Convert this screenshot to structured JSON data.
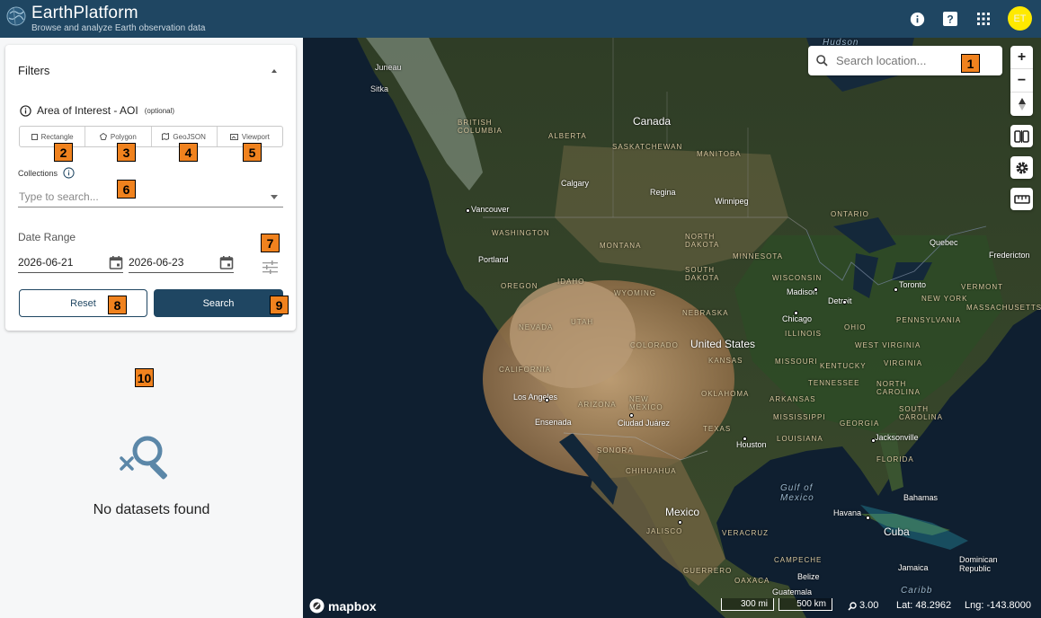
{
  "header": {
    "title": "EarthPlatform",
    "subtitle": "Browse and analyze Earth observation data",
    "avatar_initials": "ET",
    "icons": [
      "info-icon",
      "help-icon",
      "apps-grid-icon"
    ]
  },
  "filters": {
    "title": "Filters",
    "aoi_label": "Area of Interest - AOI",
    "aoi_optional": "(optional)",
    "aoi_options": [
      "Rectangle",
      "Polygon",
      "GeoJSON",
      "Viewport"
    ],
    "collections_label": "Collections",
    "collections_placeholder": "Type to search...",
    "date_range_label": "Date Range",
    "date_start": "2026-06-21",
    "date_end": "2026-06-23",
    "reset_label": "Reset",
    "search_label": "Search"
  },
  "results": {
    "empty_text": "No datasets found"
  },
  "map": {
    "search_placeholder": "Search location...",
    "zoom_in": "+",
    "zoom_out": "−",
    "attribution": "mapbox",
    "scale_mi": "300 mi",
    "scale_km": "500 km",
    "zoom_level": "3.00",
    "lat": "Lat:  48.2962",
    "lng": "Lng: -143.8000",
    "labels": {
      "hudson": "Hudson",
      "juneau": "Juneau",
      "sitka": "Sitka",
      "british_columbia": "BRITISH COLUMBIA",
      "alberta": "ALBERTA",
      "canada": "Canada",
      "saskatchewan": "SASKATCHEWAN",
      "manitoba": "MANITOBA",
      "calgary": "Calgary",
      "regina": "Regina",
      "winnipeg": "Winnipeg",
      "ontario": "ONTARIO",
      "vancouver": "Vancouver",
      "washington": "WASHINGTON",
      "montana": "MONTANA",
      "north_dakota": "NORTH DAKOTA",
      "minnesota": "MINNESOTA",
      "quebec": "Quebec",
      "fredericton": "Fredericton",
      "portland": "Portland",
      "oregon": "OREGON",
      "idaho": "IDAHO",
      "wyoming": "WYOMING",
      "south_dakota": "SOUTH DAKOTA",
      "wisconsin": "WISCONSIN",
      "madison": "Madison",
      "detroit": "Detroit",
      "toronto": "Toronto",
      "vermont": "VERMONT",
      "new_york": "NEW YORK",
      "massachusetts": "MASSACHUSETTS",
      "nebraska": "NEBRASKA",
      "chicago": "Chicago",
      "illinois": "ILLINOIS",
      "ohio": "OHIO",
      "pennsylvania": "PENNSYLVANIA",
      "nevada": "NEVADA",
      "utah": "UTAH",
      "colorado": "COLORADO",
      "united_states": "United States",
      "west_virginia": "WEST VIRGINIA",
      "virginia": "VIRGINIA",
      "california": "CALIFORNIA",
      "kansas": "KANSAS",
      "missouri": "MISSOURI",
      "kentucky": "KENTUCKY",
      "tennessee": "TENNESSEE",
      "north_carolina": "NORTH CAROLINA",
      "los_angeles": "Los Angeles",
      "arizona": "ARIZONA",
      "new_mexico": "NEW MEXICO",
      "oklahoma": "OKLAHOMA",
      "arkansas": "ARKANSAS",
      "south_carolina": "SOUTH CAROLINA",
      "ensenada": "Ensenada",
      "ciudad_juarez": "Ciudad Juárez",
      "texas": "TEXAS",
      "mississippi": "MISSISSIPPI",
      "georgia": "GEORGIA",
      "jacksonville": "Jacksonville",
      "sonora": "SONORA",
      "houston": "Houston",
      "louisiana": "LOUISIANA",
      "chihuahua": "CHIHUAHUA",
      "florida": "FLORIDA",
      "gulf_of_mexico": "Gulf of Mexico",
      "bahamas": "Bahamas",
      "mexico": "Mexico",
      "havana": "Havana",
      "cuba": "Cuba",
      "jalisco": "JALISCO",
      "veracruz": "VERACRUZ",
      "campeche": "CAMPECHE",
      "guerrero": "GUERRERO",
      "oaxaca": "OAXACA",
      "belize": "Belize",
      "jamaica": "Jamaica",
      "dominican_republic": "Dominican Republic",
      "guatemala": "Guatemala",
      "caribbean": "Caribb"
    }
  },
  "annotations": [
    "1",
    "2",
    "3",
    "4",
    "5",
    "6",
    "7",
    "8",
    "9",
    "10"
  ],
  "colors": {
    "header_bg": "#1f4662",
    "primary": "#1f4662",
    "avatar_bg": "#ffe900",
    "annotation": "#f0821e"
  }
}
